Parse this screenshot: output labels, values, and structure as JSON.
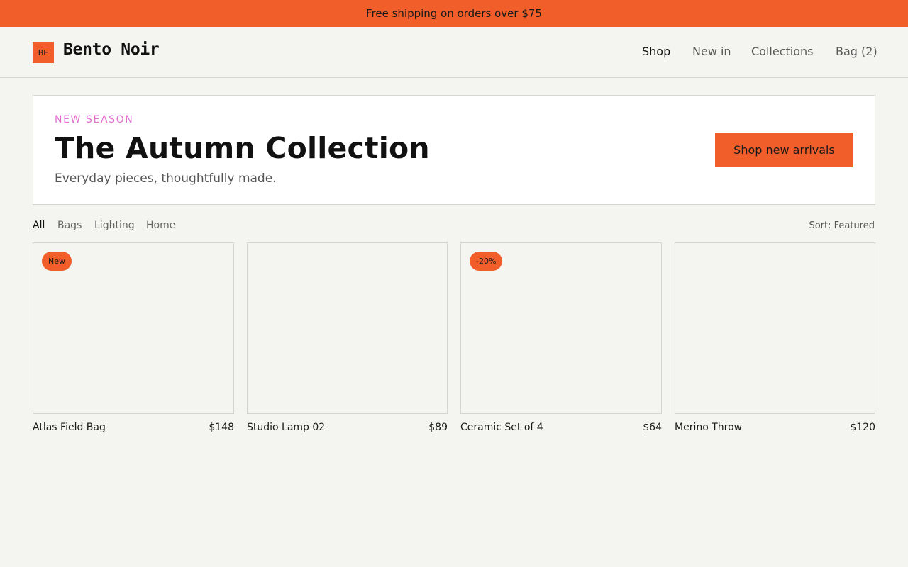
{
  "promo": {
    "text": "Free shipping on orders over $75"
  },
  "header": {
    "logo_mark": "BE",
    "brand": "Bento Noir",
    "nav": [
      {
        "label": "Shop",
        "active": true
      },
      {
        "label": "New in",
        "active": false
      },
      {
        "label": "Collections",
        "active": false
      },
      {
        "label": "Bag (2)",
        "active": false
      }
    ]
  },
  "hero": {
    "eyebrow": "NEW SEASON",
    "title": "The Autumn Collection",
    "subtitle": "Everyday pieces, thoughtfully made.",
    "cta_label": "Shop new arrivals"
  },
  "filters": {
    "tabs": [
      {
        "label": "All",
        "active": true
      },
      {
        "label": "Bags",
        "active": false
      },
      {
        "label": "Lighting",
        "active": false
      },
      {
        "label": "Home",
        "active": false
      }
    ],
    "sort_label": "Sort: Featured"
  },
  "products": [
    {
      "name": "Atlas Field Bag",
      "price": "$148",
      "badge": "New"
    },
    {
      "name": "Studio Lamp 02",
      "price": "$89",
      "badge": null
    },
    {
      "name": "Ceramic Set of 4",
      "price": "$64",
      "badge": "-20%"
    },
    {
      "name": "Merino Throw",
      "price": "$120",
      "badge": null
    }
  ],
  "colors": {
    "accent": "#f25e29",
    "eyebrow": "#e56fd0",
    "background": "#f4f4f0",
    "border": "#d4d4d0"
  }
}
